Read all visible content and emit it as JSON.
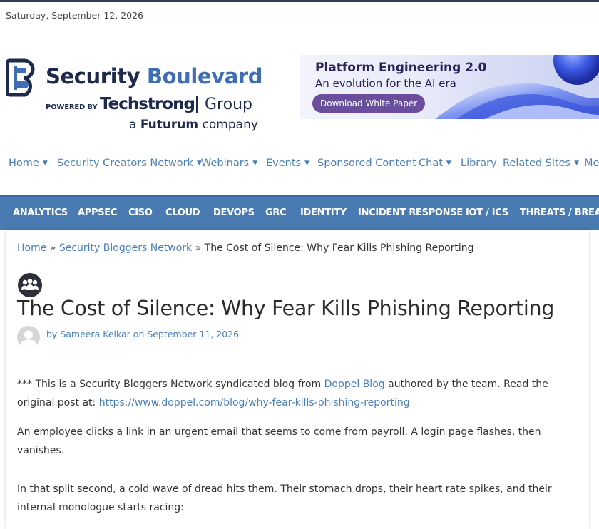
{
  "date": "Saturday, September 12, 2026",
  "brand": {
    "title_word1": "Security",
    "title_word2": "Boulevard",
    "powered_by": "POWERED BY",
    "techstrong": "Techstrong",
    "group": "Group",
    "company_prefix": "a",
    "company_name": "Futurum",
    "company_suffix": "company"
  },
  "ad": {
    "title": "Platform Engineering 2.0",
    "subtitle": "An evolution for the AI era",
    "button": "Download White Paper"
  },
  "topnav": [
    {
      "label": "Home",
      "dropdown": true
    },
    {
      "label": "Security Creators Network",
      "dropdown": true
    },
    {
      "label": "Webinars",
      "dropdown": true
    },
    {
      "label": "Events",
      "dropdown": true
    },
    {
      "label": "Sponsored Content",
      "dropdown": false
    },
    {
      "label": "Chat",
      "dropdown": true
    },
    {
      "label": "Library",
      "dropdown": false
    },
    {
      "label": "Related Sites",
      "dropdown": true
    },
    {
      "label": "Me",
      "dropdown": false
    }
  ],
  "categories": [
    "ANALYTICS",
    "APPSEC",
    "CISO",
    "CLOUD",
    "DEVOPS",
    "GRC",
    "IDENTITY",
    "INCIDENT RESPONSE",
    "IOT / ICS",
    "THREATS / BREACH"
  ],
  "breadcrumb": {
    "home": "Home",
    "section": "Security Bloggers Network",
    "separator": "»",
    "current": "The Cost of Silence: Why Fear Kills Phishing Reporting"
  },
  "post": {
    "title": "The Cost of Silence: Why Fear Kills Phishing Reporting",
    "by": "by",
    "author": "Sameera Kelkar",
    "on": "on",
    "date": "September 11, 2026"
  },
  "body": {
    "syndication_prefix": "*** This is a Security Bloggers Network syndicated blog from",
    "source_link": "Doppel Blog",
    "syndication_suffix": "authored by the team. Read the original post at:",
    "original_url": "https://www.doppel.com/blog/why-fear-kills-phishing-reporting",
    "para1": "An employee clicks a link in an urgent email that seems to come from payroll. A login page flashes, then vanishes.",
    "para2": "In that split second, a cold wave of dread hits them. Their stomach drops, their heart rate spikes, and their internal monologue starts racing:"
  },
  "colors": {
    "accent_link": "#4a7fb6",
    "category_bar": "#4a7ab2",
    "brand_dark": "#1d2a4d",
    "brand_blue": "#3f6fb2",
    "ad_button": "#6a4d9b"
  }
}
